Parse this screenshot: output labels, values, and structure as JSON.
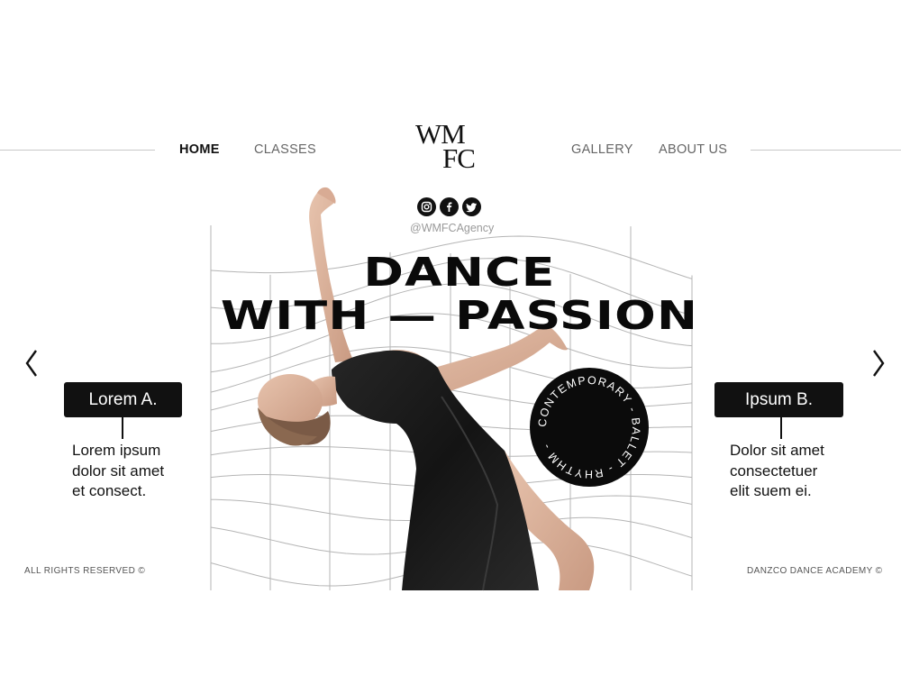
{
  "nav": {
    "home": "HOME",
    "classes": "CLASSES",
    "gallery": "GALLERY",
    "about": "ABOUT US"
  },
  "logo": {
    "line1": "WM",
    "line2": "FC"
  },
  "social": {
    "icons": [
      "instagram-icon",
      "facebook-icon",
      "twitter-icon"
    ],
    "handle": "@WMFCAgency"
  },
  "hero": {
    "headline_line1": "DANCE",
    "headline_line2": "WITH — PASSION"
  },
  "badge": {
    "text": "CONTEMPORARY - BALLET - RHYTHM -"
  },
  "left_card": {
    "label": "Lorem A.",
    "desc_lines": [
      "Lorem ipsum",
      "dolor sit amet",
      "et consect."
    ]
  },
  "right_card": {
    "label": "Ipsum B.",
    "desc_lines": [
      "Dolor sit amet",
      "consectetuer",
      "elit suem ei."
    ]
  },
  "footer": {
    "left": "ALL RIGHTS RESERVED ©",
    "right": "DANZCO DANCE ACADEMY ©"
  },
  "colors": {
    "ink": "#111111",
    "muted": "#666666",
    "line": "#c8c8c8",
    "grid": "#b5b5b5"
  }
}
